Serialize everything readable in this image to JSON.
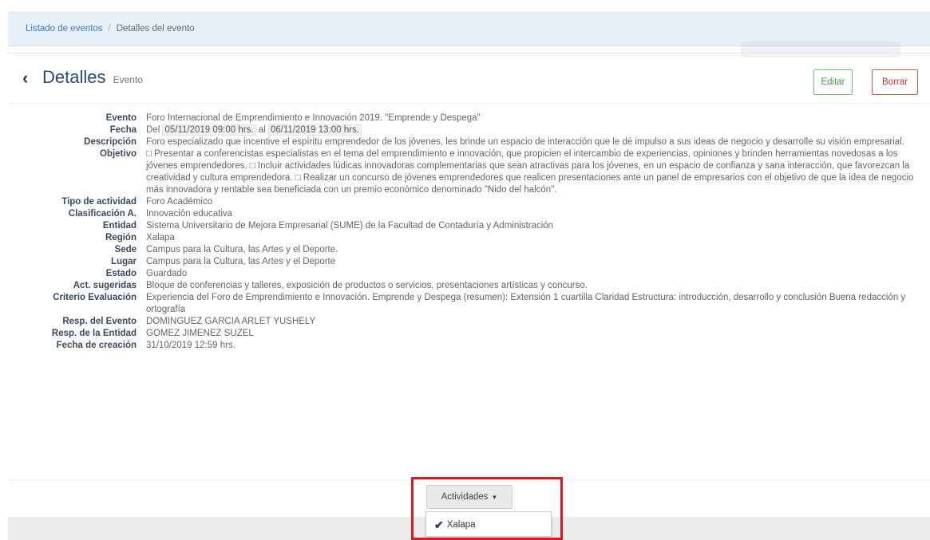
{
  "breadcrumb": {
    "link": "Listado de eventos",
    "separator": "/",
    "current": "Detalles del evento"
  },
  "header": {
    "title": "Detalles",
    "subtitle": "Evento",
    "back_icon": "chevron-left-icon",
    "edit_label": "Editar",
    "delete_label": "Borrar"
  },
  "details": {
    "evento": {
      "label": "Evento",
      "value": "Foro Internacional de Emprendimiento e Innovación 2019. \"Emprende y Despega\""
    },
    "fecha": {
      "label": "Fecha",
      "prefix": "Del",
      "start": "05/11/2019 09:00 hrs.",
      "middle": "al",
      "end": "06/11/2019 13:00 hrs."
    },
    "descripcion": {
      "label": "Descripción",
      "value": "Foro especializado que incentive el espíritu emprendedor de los jóvenes, les brinde un espacio de interacción que le dé impulso a sus ideas de negocio y desarrolle su visión empresarial."
    },
    "objetivo": {
      "label": "Objetivo",
      "value": "□ Presentar a conferencistas especialistas en el tema del emprendimiento e innovación, que propicien el intercambio de experiencias, opiniones y brinden herramientas novedosas a los jóvenes emprendedores. □ Incluir actividades lúdicas innovadoras complementarias que sean atractivas para los jóvenes, en un espacio de confianza y sana interacción, que favorezcan la creatividad y cultura emprendedora. □ Realizar un concurso de jóvenes emprendedores que realicen presentaciones ante un panel de empresarios con el objetivo de que la idea de negocio más innovadora y rentable sea beneficiada con un premio económico denominado \"Nido del halcón\"."
    },
    "tipo": {
      "label": "Tipo de actividad",
      "value": "Foro Académico"
    },
    "clasificacion": {
      "label": "Clasificación A.",
      "value": "Innovación educativa"
    },
    "entidad": {
      "label": "Entidad",
      "value": "Sistema Universitario de Mejora Empresarial (SUME) de la Facultad de Contaduría y Administración"
    },
    "region": {
      "label": "Región",
      "value": "Xalapa"
    },
    "sede": {
      "label": "Sede",
      "value": "Campus para la Cultura, las Artes y el Deporte."
    },
    "lugar": {
      "label": "Lugar",
      "value": "Campus para la Cultura, las Artes y el Deporte"
    },
    "estado": {
      "label": "Estado",
      "value": "Guardado"
    },
    "act_sugeridas": {
      "label": "Act. sugeridas",
      "value": "Bloque de conferencias y talleres, exposición de productos o servicios, presentaciones artísticas y concurso."
    },
    "criterio": {
      "label": "Criterio Evaluación",
      "value": "Experiencia del Foro de Emprendimiento e Innovación. Emprende y Despega (resumen): Extensión 1 cuartilla Claridad Estructura: introducción, desarrollo y conclusión Buena redacción y ortografía"
    },
    "resp_evento": {
      "label": "Resp. del Evento",
      "value": "DOMINGUEZ GARCIA ARLET YUSHELY"
    },
    "resp_entidad": {
      "label": "Resp. de la Entidad",
      "value": "GOMEZ JIMENEZ SUZEL"
    },
    "fecha_creacion": {
      "label": "Fecha de creación",
      "value": "31/10/2019 12:59 hrs."
    }
  },
  "actividades": {
    "button_label": "Actividades",
    "caret_icon": "caret-down-icon",
    "items": [
      {
        "label": "Xalapa",
        "icon": "check-icon",
        "selected": true
      }
    ]
  },
  "colors": {
    "highlight": "#e01820",
    "edit": "#4a9d4a",
    "delete": "#c9302c",
    "title": "#2d4a6b"
  }
}
